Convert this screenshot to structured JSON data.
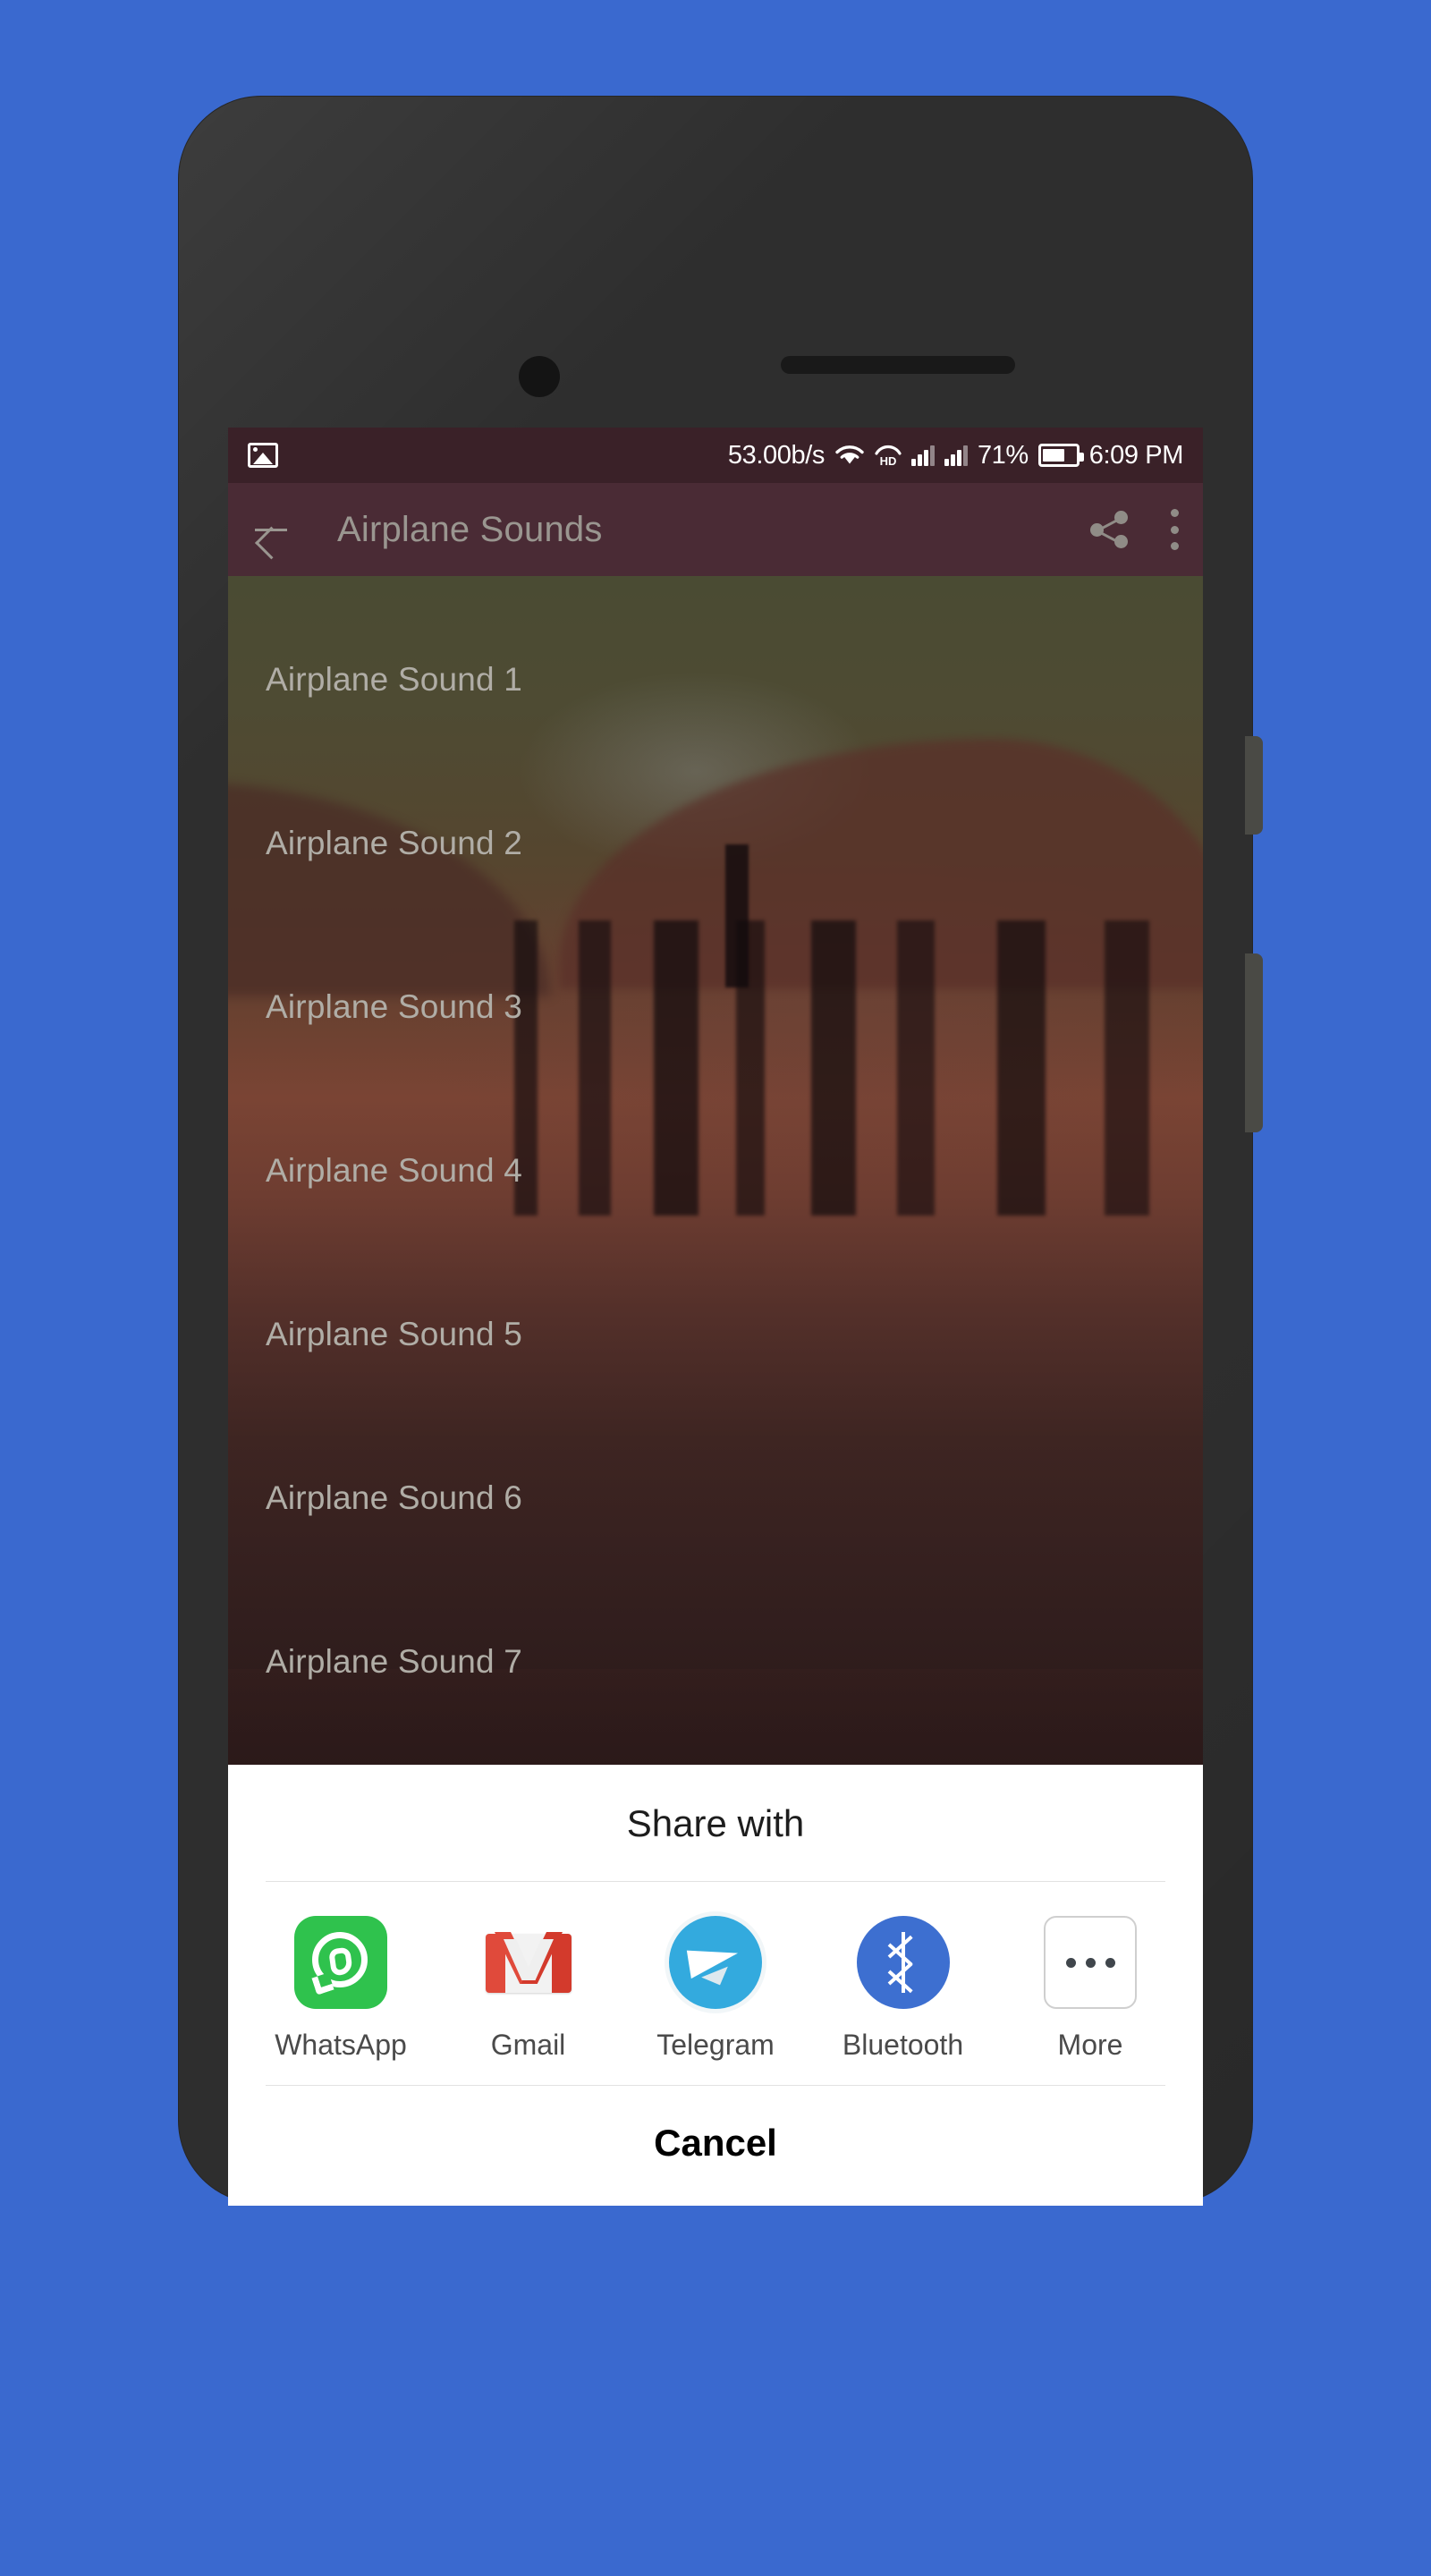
{
  "theme": {
    "page_background": "#3A69CF",
    "device_body": "#2E2E2E",
    "status_bar_bg": "#3A2128",
    "toolbar_bg": "#4A2B35",
    "toolbar_text": "#9A9690",
    "sheet_bg": "#FFFFFF",
    "list_text": "#B0ADA6"
  },
  "status_bar": {
    "photo_icon": "image-icon",
    "network_speed": "53.00b/s",
    "wifi_icon": "wifi-icon",
    "hd_label": "HD",
    "sim1_icon": "signal-bars-sim1",
    "sim2_icon": "signal-bars-sim2",
    "battery_percent": "71%",
    "battery_icon": "battery-icon",
    "clock": "6:09 PM"
  },
  "toolbar": {
    "back_icon": "arrow-back-icon",
    "title": "Airplane Sounds",
    "share_icon": "share-icon",
    "overflow_icon": "more-vert-icon"
  },
  "list": {
    "items": [
      {
        "label": "Airplane Sound 1"
      },
      {
        "label": "Airplane Sound 2"
      },
      {
        "label": "Airplane Sound 3"
      },
      {
        "label": "Airplane Sound 4"
      },
      {
        "label": "Airplane Sound 5"
      },
      {
        "label": "Airplane Sound 6"
      },
      {
        "label": "Airplane Sound 7"
      }
    ]
  },
  "share_sheet": {
    "title": "Share with",
    "cancel_label": "Cancel",
    "targets": [
      {
        "label": "WhatsApp",
        "icon": "whatsapp-icon",
        "color": "#2FC24D"
      },
      {
        "label": "Gmail",
        "icon": "gmail-icon",
        "color": "#E04A3B"
      },
      {
        "label": "Telegram",
        "icon": "telegram-icon",
        "color": "#33AADE"
      },
      {
        "label": "Bluetooth",
        "icon": "bluetooth-icon",
        "color": "#3D6FD0"
      },
      {
        "label": "More",
        "icon": "more-horiz-icon",
        "color": "#40464C"
      }
    ]
  },
  "device": {
    "front_camera": "front-camera",
    "earpiece": "earpiece-speaker",
    "power_button": "power-button",
    "volume_button": "volume-button"
  }
}
